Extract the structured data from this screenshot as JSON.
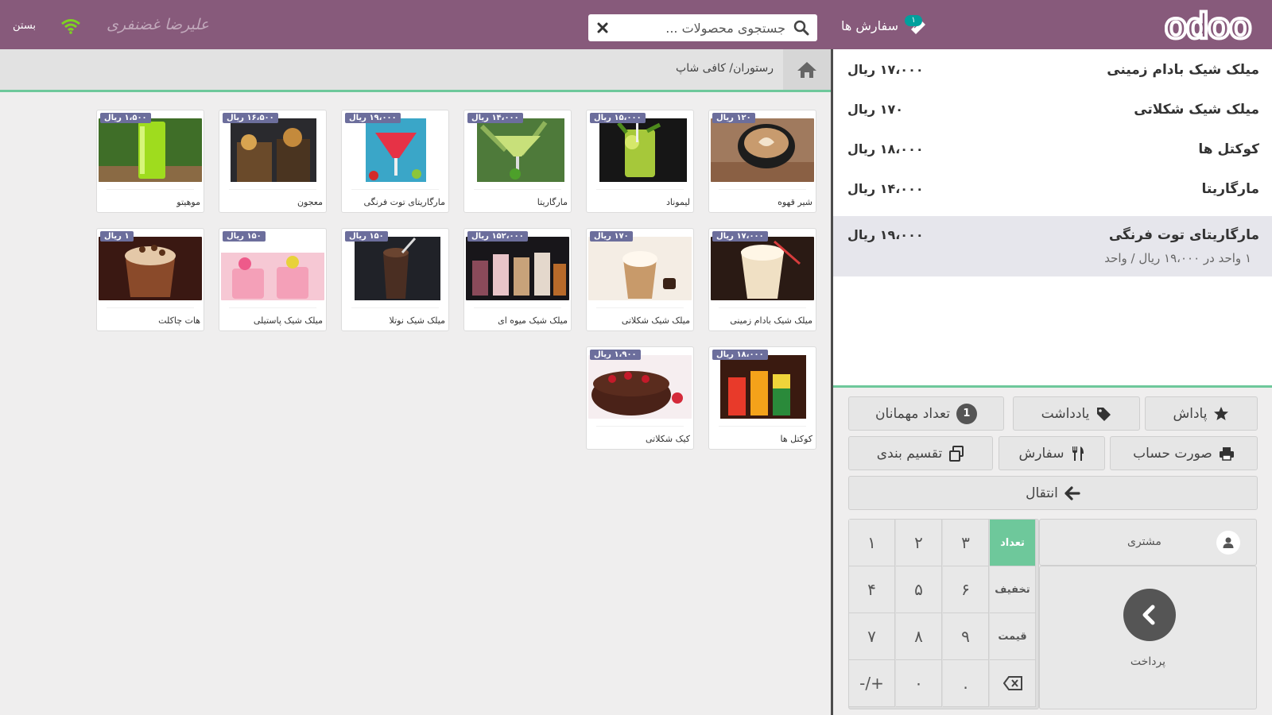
{
  "header": {
    "logo_text": "odoo",
    "orders_label": "سفارش ها",
    "orders_count": "۱",
    "search_placeholder": "جستجوی محصولات ...",
    "user_name": "علیرضا غضنفری",
    "close_label": "بستن"
  },
  "breadcrumb": {
    "path": "رستوران/ کافی شاپ"
  },
  "products": [
    {
      "name": "شیر قهوه",
      "price": "۱۲۰ ریال"
    },
    {
      "name": "لیموناد",
      "price": "۱۵،۰۰۰ ریال"
    },
    {
      "name": "مارگاریتا",
      "price": "۱۴،۰۰۰ ریال"
    },
    {
      "name": "مارگاریتای توت فرنگی",
      "price": "۱۹،۰۰۰ ریال"
    },
    {
      "name": "معجون",
      "price": "۱۶،۵۰۰ ریال"
    },
    {
      "name": "موهیتو",
      "price": "۱،۵۰۰ ریال"
    },
    {
      "name": "میلک شیک بادام زمینی",
      "price": "۱۷،۰۰۰ ریال"
    },
    {
      "name": "میلک شیک شکلاتی",
      "price": "۱۷۰ ریال"
    },
    {
      "name": "میلک شیک میوه ای",
      "price": "۱۵۲،۰۰۰ ریال"
    },
    {
      "name": "میلک شیک نوتلا",
      "price": "۱۵۰ ریال"
    },
    {
      "name": "میلک شیک پاستیلی",
      "price": "۱۵۰ ریال"
    },
    {
      "name": "هات چاکلت",
      "price": "۱ ریال"
    },
    {
      "name": "کوکتل ها",
      "price": "۱۸،۰۰۰ ریال"
    },
    {
      "name": "کیک شکلاتی",
      "price": "۱،۹۰۰ ریال"
    }
  ],
  "orderlines": [
    {
      "name": "میلک شیک بادام زمینی",
      "price": "۱۷،۰۰۰ ریال"
    },
    {
      "name": "میلک شیک شکلاتی",
      "price": "۱۷۰ ریال"
    },
    {
      "name": "کوکتل ها",
      "price": "۱۸،۰۰۰ ریال"
    },
    {
      "name": "مارگاریتا",
      "price": "۱۴،۰۰۰ ریال"
    },
    {
      "name": "مارگاریتای توت فرنگی",
      "price": "۱۹،۰۰۰ ریال",
      "info": "۱ واحد در ۱۹،۰۰۰ ریال / واحد"
    }
  ],
  "controls": {
    "reward": "پاداش",
    "note": "یادداشت",
    "guests": "تعداد مهمانان",
    "guest_count": "1",
    "bill": "صورت حساب",
    "order": "سفارش",
    "split": "تقسیم بندی",
    "transfer": "انتقال"
  },
  "numpad": {
    "keys": [
      "۱",
      "۲",
      "۳",
      "۴",
      "۵",
      "۶",
      "۷",
      "۸",
      "۹",
      "-/+",
      "۰",
      "."
    ],
    "mode_qty": "تعداد",
    "mode_disc": "تخفیف",
    "mode_price": "قیمت",
    "customer": "مشتری",
    "payment": "پرداخت"
  },
  "colors": {
    "header": "#875a7b",
    "accent_green": "#6ec89b",
    "price_tag": "#6c6e9c",
    "badge": "#00a09d"
  }
}
